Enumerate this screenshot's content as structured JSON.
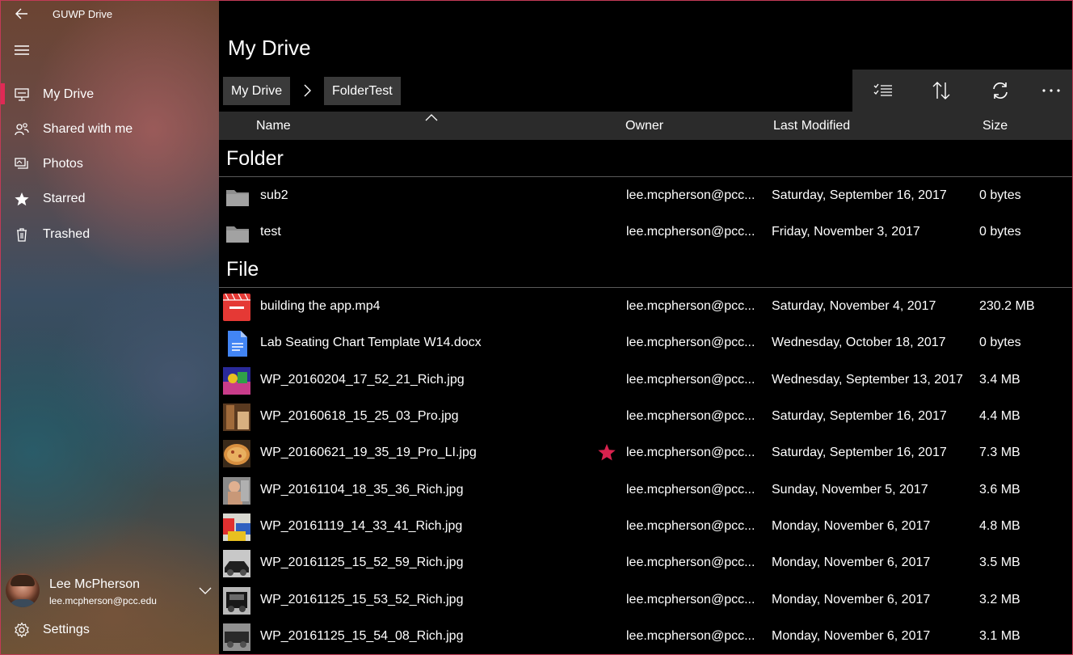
{
  "app": {
    "title": "GUWP Drive"
  },
  "sidebar": {
    "items": [
      {
        "label": "My Drive",
        "icon": "my-drive-icon",
        "active": true
      },
      {
        "label": "Shared with me",
        "icon": "shared-icon",
        "active": false
      },
      {
        "label": "Photos",
        "icon": "photos-icon",
        "active": false
      },
      {
        "label": "Starred",
        "icon": "star-icon",
        "active": false
      },
      {
        "label": "Trashed",
        "icon": "trash-icon",
        "active": false
      }
    ],
    "account": {
      "name": "Lee McPherson",
      "email": "lee.mcpherson@pcc.edu"
    },
    "settings_label": "Settings"
  },
  "main": {
    "title": "My Drive",
    "breadcrumb": [
      "My Drive",
      "FolderTest"
    ],
    "columns": {
      "name": "Name",
      "owner": "Owner",
      "modified": "Last Modified",
      "size": "Size"
    },
    "folder_group": "Folder",
    "file_group": "File",
    "folders": [
      {
        "name": "sub2",
        "owner": "lee.mcpherson@pcc...",
        "modified": "Saturday, September 16, 2017",
        "size": "0 bytes"
      },
      {
        "name": "test",
        "owner": "lee.mcpherson@pcc...",
        "modified": "Friday, November 3, 2017",
        "size": "0 bytes"
      }
    ],
    "files": [
      {
        "name": "building the app.mp4",
        "owner": "lee.mcpherson@pcc...",
        "modified": "Saturday, November 4, 2017",
        "size": "230.2 MB",
        "type": "video",
        "starred": false
      },
      {
        "name": "Lab Seating Chart Template W14.docx",
        "owner": "lee.mcpherson@pcc...",
        "modified": "Wednesday, October 18, 2017",
        "size": "0 bytes",
        "type": "doc",
        "starred": false
      },
      {
        "name": "WP_20160204_17_52_21_Rich.jpg",
        "owner": "lee.mcpherson@pcc...",
        "modified": "Wednesday, September 13, 2017",
        "size": "3.4 MB",
        "type": "image",
        "starred": false
      },
      {
        "name": "WP_20160618_15_25_03_Pro.jpg",
        "owner": "lee.mcpherson@pcc...",
        "modified": "Saturday, September 16, 2017",
        "size": "4.4 MB",
        "type": "image",
        "starred": false
      },
      {
        "name": "WP_20160621_19_35_19_Pro_LI.jpg",
        "owner": "lee.mcpherson@pcc...",
        "modified": "Saturday, September 16, 2017",
        "size": "7.3 MB",
        "type": "image",
        "starred": true
      },
      {
        "name": "WP_20161104_18_35_36_Rich.jpg",
        "owner": "lee.mcpherson@pcc...",
        "modified": "Sunday, November 5, 2017",
        "size": "3.6 MB",
        "type": "image",
        "starred": false
      },
      {
        "name": "WP_20161119_14_33_41_Rich.jpg",
        "owner": "lee.mcpherson@pcc...",
        "modified": "Monday, November 6, 2017",
        "size": "4.8 MB",
        "type": "image",
        "starred": false
      },
      {
        "name": "WP_20161125_15_52_59_Rich.jpg",
        "owner": "lee.mcpherson@pcc...",
        "modified": "Monday, November 6, 2017",
        "size": "3.5 MB",
        "type": "image",
        "starred": false
      },
      {
        "name": "WP_20161125_15_53_52_Rich.jpg",
        "owner": "lee.mcpherson@pcc...",
        "modified": "Monday, November 6, 2017",
        "size": "3.2 MB",
        "type": "image",
        "starred": false
      },
      {
        "name": "WP_20161125_15_54_08_Rich.jpg",
        "owner": "lee.mcpherson@pcc...",
        "modified": "Monday, November 6, 2017",
        "size": "3.1 MB",
        "type": "image",
        "starred": false
      }
    ]
  },
  "colors": {
    "accent": "#e02a55",
    "star": "#d9224e",
    "header_bg": "#2b2b2b",
    "crumb_bg": "#3a3a3a"
  }
}
